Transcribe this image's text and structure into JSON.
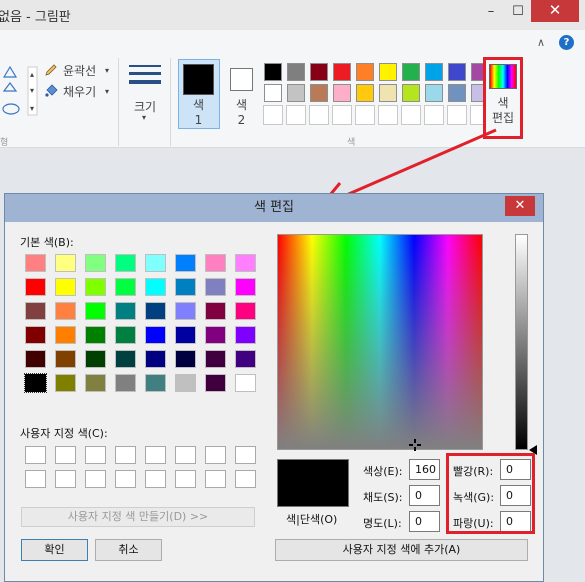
{
  "window": {
    "title": "없음 - 그림판",
    "minimize": "–",
    "maximize": "☐",
    "close": "✕",
    "help": "?",
    "collapse": "∧"
  },
  "ribbon": {
    "outline_label": "윤곽선",
    "fill_label": "채우기",
    "shapes_group_fragment": "형",
    "size_label": "크기",
    "color1_label": "색 1",
    "color2_label": "색 2",
    "colors_group_label": "색",
    "edit_colors_label": "색 편집",
    "color1_value": "#000000",
    "color2_value": "#ffffff",
    "palette_row1": [
      "#000000",
      "#7f7f7f",
      "#880015",
      "#ed1c24",
      "#ff7f27",
      "#fff200",
      "#22b14c",
      "#00a2e8",
      "#3f48cc",
      "#a349a4"
    ],
    "palette_row2": [
      "#ffffff",
      "#c3c3c3",
      "#b97a57",
      "#ffaec9",
      "#ffc90e",
      "#efe4b0",
      "#b5e61d",
      "#99d9ea",
      "#7092be",
      "#c8bfe7"
    ]
  },
  "dialog": {
    "title": "색 편집",
    "close": "✕",
    "basic_colors_label": "기본 색(B):",
    "custom_colors_label": "사용자 지정 색(C):",
    "define_custom_button": "사용자 지정 색 만들기(D) >>",
    "ok_button": "확인",
    "cancel_button": "취소",
    "color_solid_label": "색|단색(O)",
    "add_custom_button": "사용자 지정 색에 추가(A)",
    "hue_label": "색상(E):",
    "sat_label": "채도(S):",
    "lum_label": "명도(L):",
    "red_label": "빨강(R):",
    "green_label": "녹색(G):",
    "blue_label": "파랑(U):",
    "hue": "160",
    "sat": "0",
    "lum": "0",
    "red": "0",
    "green": "0",
    "blue": "0",
    "preview_color": "#000000",
    "basic_colors": [
      [
        "#ff8080",
        "#ffff80",
        "#80ff80",
        "#00ff80",
        "#80ffff",
        "#0080ff",
        "#ff80c0",
        "#ff80ff"
      ],
      [
        "#ff0000",
        "#ffff00",
        "#80ff00",
        "#00ff40",
        "#00ffff",
        "#0080c0",
        "#8080c0",
        "#ff00ff"
      ],
      [
        "#804040",
        "#ff8040",
        "#00ff00",
        "#008080",
        "#004080",
        "#8080ff",
        "#800040",
        "#ff0080"
      ],
      [
        "#800000",
        "#ff8000",
        "#008000",
        "#008040",
        "#0000ff",
        "#0000a0",
        "#800080",
        "#8000ff"
      ],
      [
        "#400000",
        "#804000",
        "#004000",
        "#004040",
        "#000080",
        "#000040",
        "#400040",
        "#400080"
      ],
      [
        "#000000",
        "#808000",
        "#808040",
        "#808080",
        "#408080",
        "#c0c0c0",
        "#400040",
        "#ffffff"
      ]
    ]
  }
}
